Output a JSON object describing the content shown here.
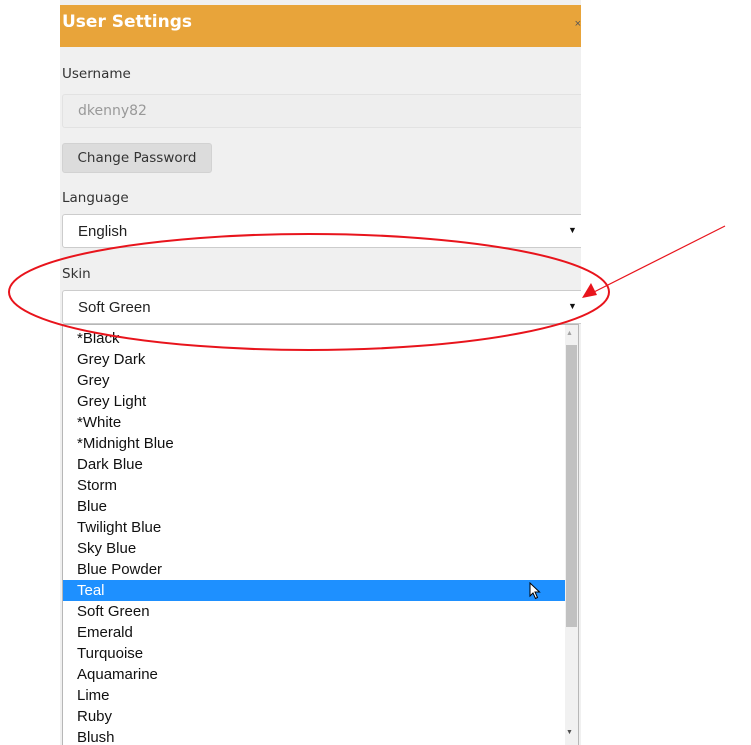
{
  "dialog": {
    "title": "User Settings"
  },
  "username": {
    "label": "Username",
    "value": "dkenny82"
  },
  "change_password": {
    "label": "Change Password"
  },
  "language": {
    "label": "Language",
    "value": "English"
  },
  "skin": {
    "label": "Skin",
    "value": "Soft Green",
    "options": [
      "*Black",
      "Grey Dark",
      "Grey",
      "Grey Light",
      "*White",
      "*Midnight Blue",
      "Dark Blue",
      "Storm",
      "Blue",
      "Twilight Blue",
      "Sky Blue",
      "Blue Powder",
      "Teal",
      "Soft Green",
      "Emerald",
      "Turquoise",
      "Aquamarine",
      "Lime",
      "Ruby",
      "Blush"
    ],
    "highlighted_option": "Teal"
  },
  "colors": {
    "header": "#e8a43a",
    "highlight": "#1e90ff",
    "annotation": "#e8141c"
  },
  "icons": {
    "select_caret": "caret-down-icon",
    "mouse": "mouse-pointer-icon",
    "annotation_arrow": "arrow-icon",
    "annotation_ellipse": "ellipse-highlight"
  }
}
